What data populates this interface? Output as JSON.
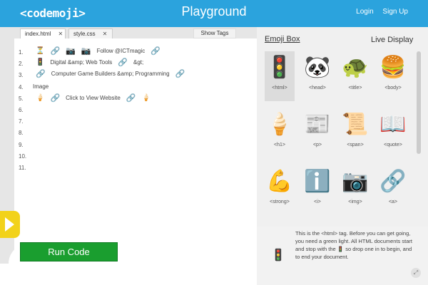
{
  "header": {
    "logo": "<codemoji>",
    "title": "Playground",
    "login": "Login",
    "signup": "Sign Up"
  },
  "tabs": [
    {
      "label": "index.html"
    },
    {
      "label": "style.css"
    }
  ],
  "show_tags": "Show Tags",
  "line_numbers": [
    "1.",
    "2.",
    "3.",
    "4.",
    "5.",
    "6.",
    "7.",
    "8.",
    "9.",
    "10.",
    "11."
  ],
  "code": {
    "line1_text": "Follow @ICTmagic",
    "line2_text": "Digital &amp; Web Tools",
    "line2_tail": "&gt;",
    "line3_text": "Computer Game Builders &amp; Programming",
    "line4_text": "Image",
    "line5_text": "Click to View Website"
  },
  "run_button": "Run Code",
  "emoji_box": {
    "title": "Emoji Box",
    "live_display": "Live Display",
    "items": [
      {
        "icon": "🚦",
        "label": "<html>",
        "name": "traffic-light-icon"
      },
      {
        "icon": "🐼",
        "label": "<head>",
        "name": "panda-icon"
      },
      {
        "icon": "🐢",
        "label": "<title>",
        "name": "turtle-icon"
      },
      {
        "icon": "🍔",
        "label": "<body>",
        "name": "burger-icon"
      },
      {
        "icon": "🍦",
        "label": "<h1>",
        "name": "ice-cream-icon"
      },
      {
        "icon": "📰",
        "label": "<p>",
        "name": "newspaper-icon"
      },
      {
        "icon": "📜",
        "label": "<span>",
        "name": "scroll-icon"
      },
      {
        "icon": "📖",
        "label": "<quote>",
        "name": "book-icon"
      },
      {
        "icon": "💪",
        "label": "<strong>",
        "name": "muscle-icon"
      },
      {
        "icon": "ℹ️",
        "label": "<i>",
        "name": "info-icon"
      },
      {
        "icon": "📷",
        "label": "<img>",
        "name": "camera-icon"
      },
      {
        "icon": "🔗",
        "label": "<a>",
        "name": "link-icon"
      }
    ]
  },
  "description": {
    "icon": "🚦",
    "text": "This is the <html> tag. Before you can get going, you need a green light. All HTML documents start and stop with the 🚦 so drop one in to begin, and to end your document."
  }
}
